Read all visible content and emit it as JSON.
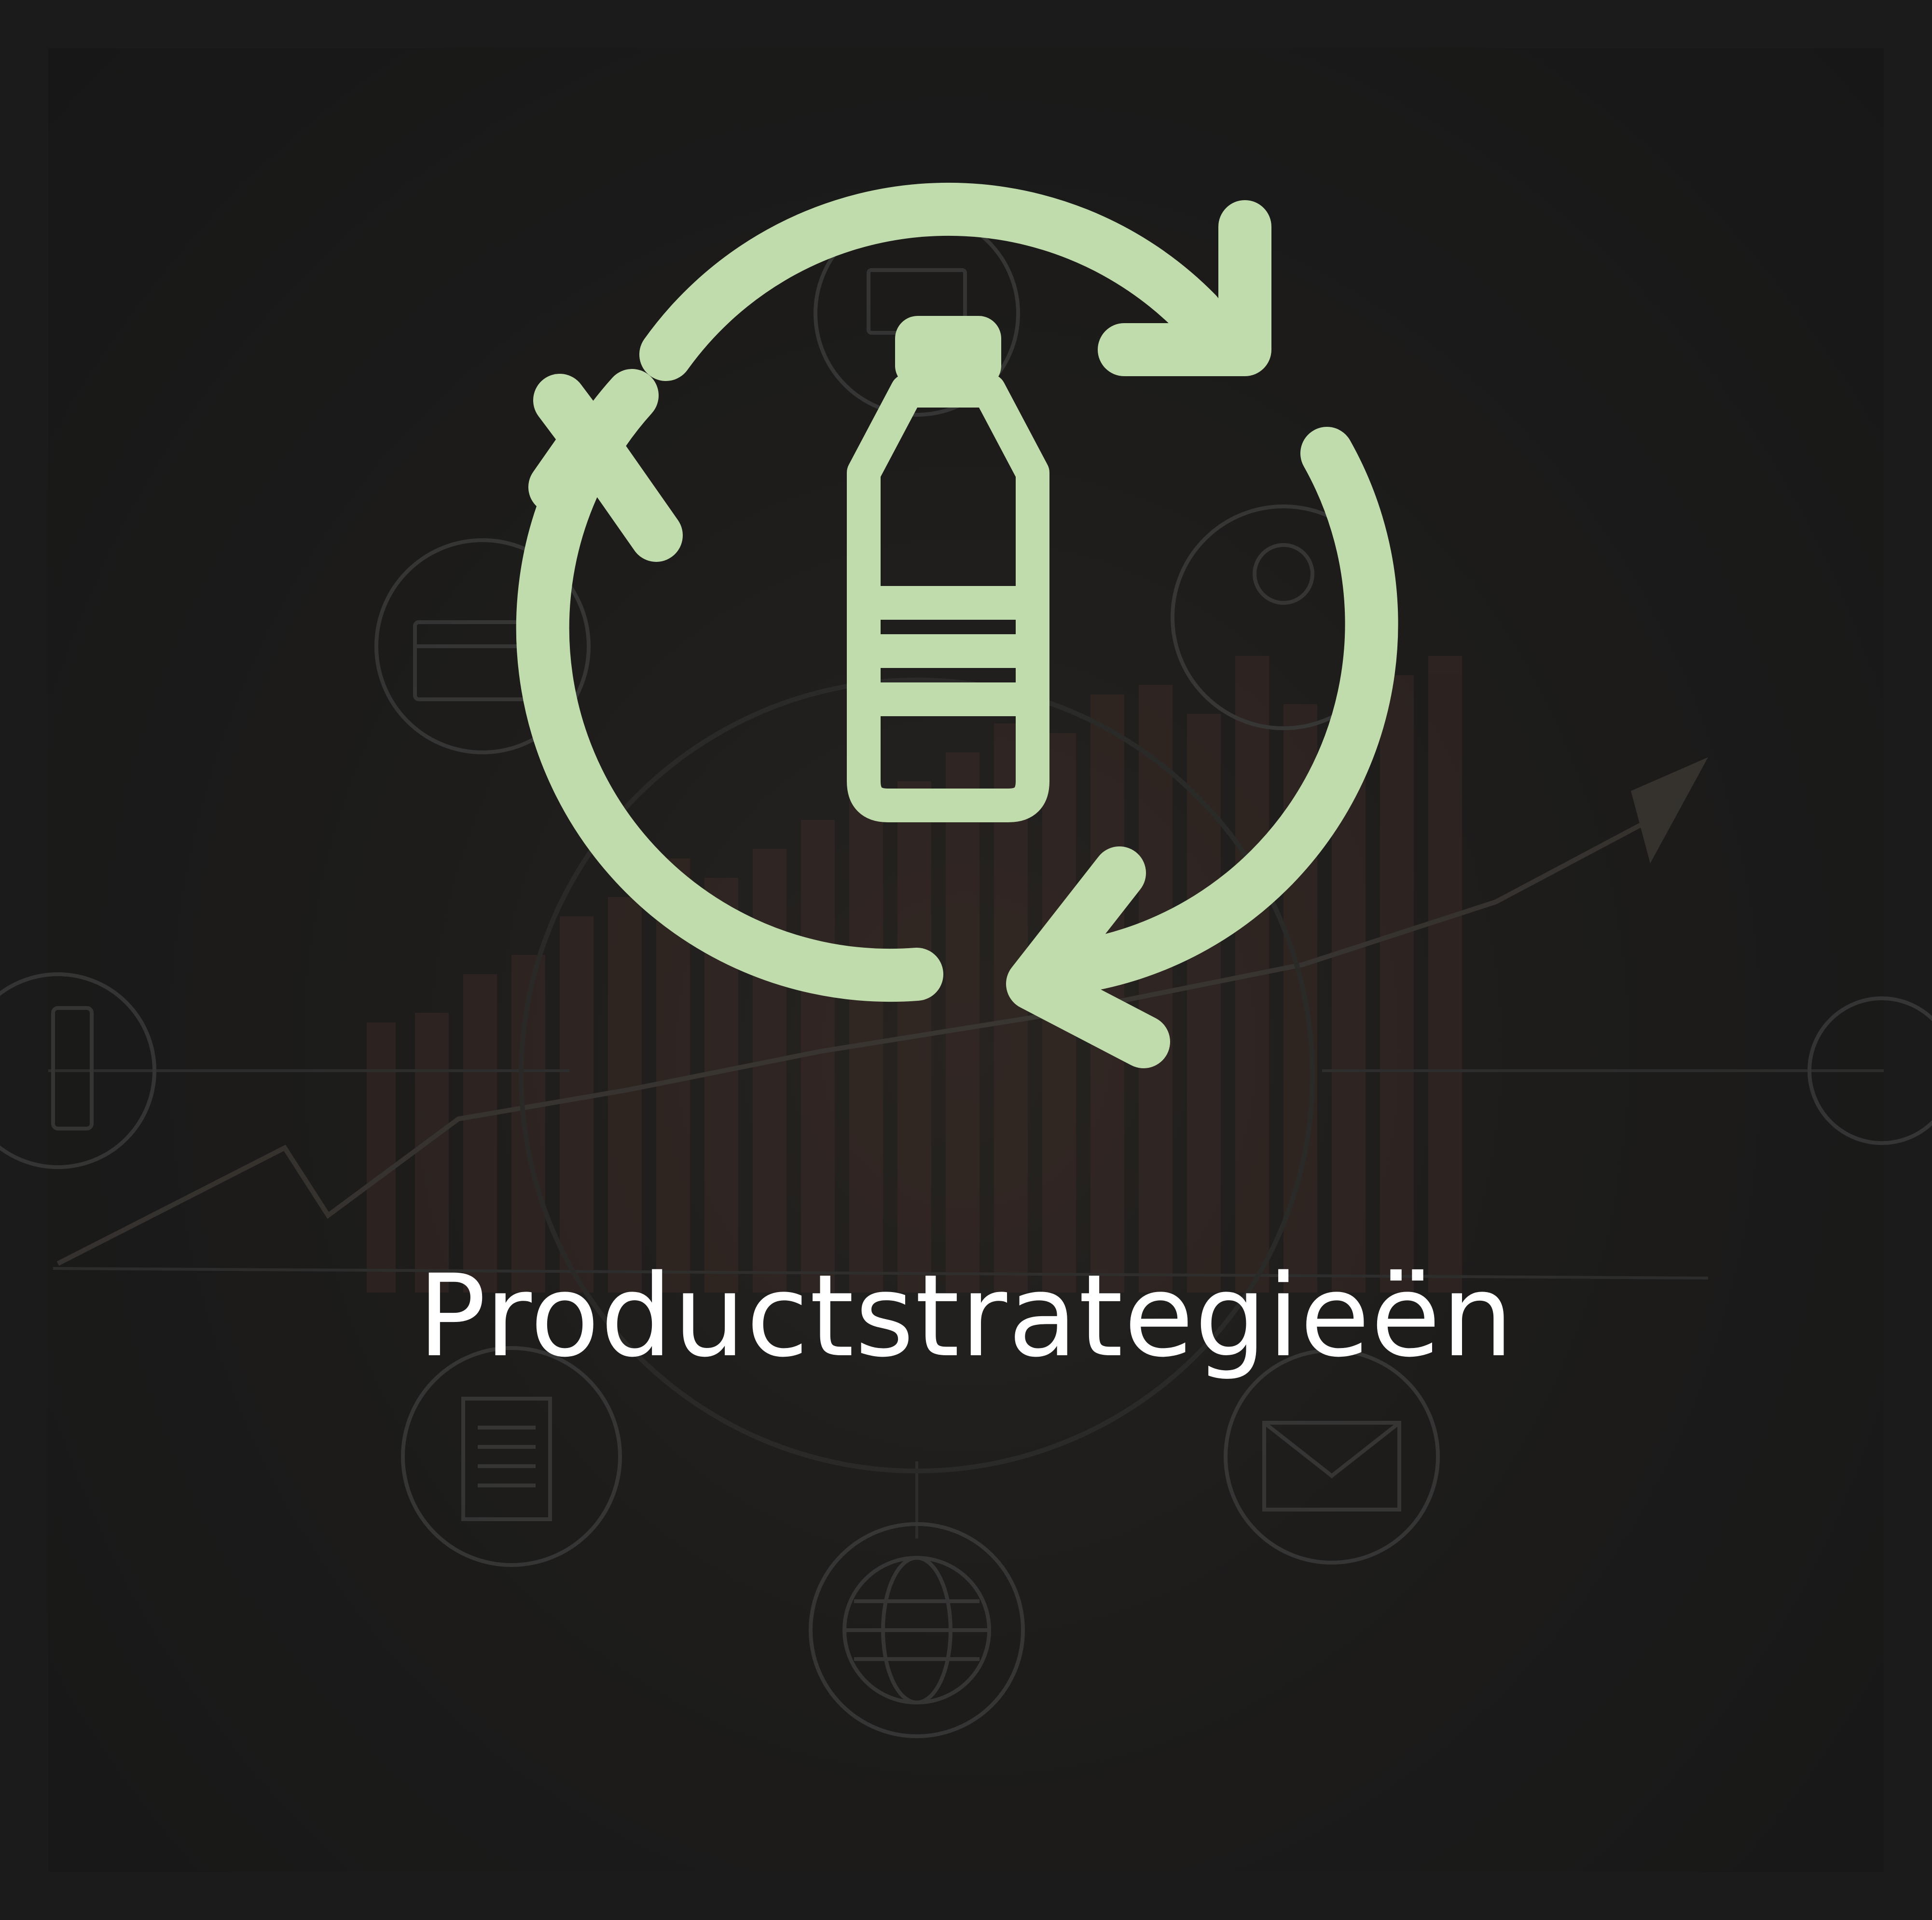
{
  "card": {
    "title": "Productstrategieën"
  },
  "colors": {
    "background": "#1b1b1b",
    "icon_accent": "#c0dbac",
    "text": "#ffffff"
  },
  "icons": {
    "main": "recycle-bottle-icon",
    "background": [
      "laptop-icon",
      "credit-card-icon",
      "user-icon",
      "tablet-icon",
      "document-icon",
      "globe-icon",
      "mail-icon",
      "currency-icon",
      "bar-chart",
      "trend-arrow-icon"
    ]
  }
}
